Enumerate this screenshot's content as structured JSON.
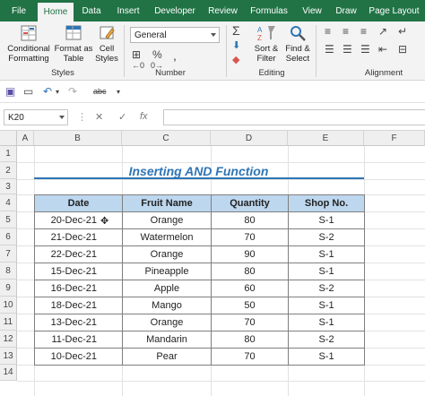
{
  "tabs": [
    {
      "label": "File",
      "active": false
    },
    {
      "label": "Home",
      "active": true
    },
    {
      "label": "Data",
      "active": false
    },
    {
      "label": "Insert",
      "active": false
    },
    {
      "label": "Developer",
      "active": false
    },
    {
      "label": "Review",
      "active": false
    },
    {
      "label": "Formulas",
      "active": false
    },
    {
      "label": "View",
      "active": false
    },
    {
      "label": "Draw",
      "active": false
    },
    {
      "label": "Page Layout",
      "active": false
    }
  ],
  "ribbon": {
    "styles": {
      "conditional_formatting": [
        "Conditional",
        "Formatting"
      ],
      "format_as_table": [
        "Format as",
        "Table"
      ],
      "cell_styles": [
        "Cell",
        "Styles"
      ],
      "group_label": "Styles"
    },
    "number": {
      "format_value": "General",
      "group_label": "Number"
    },
    "editing": {
      "sort_filter": [
        "Sort &",
        "Filter"
      ],
      "find_select": [
        "Find &",
        "Select"
      ],
      "group_label": "Editing"
    },
    "alignment": {
      "group_label": "Alignment"
    }
  },
  "formula_bar": {
    "name_box": "K20",
    "formula": ""
  },
  "columns": [
    "A",
    "B",
    "C",
    "D",
    "E",
    "F"
  ],
  "rows": [
    "1",
    "2",
    "3",
    "4",
    "5",
    "6",
    "7",
    "8",
    "9",
    "10",
    "11",
    "12",
    "13",
    "14"
  ],
  "sheet": {
    "title": "Inserting AND Function",
    "headers": [
      "Date",
      "Fruit Name",
      "Quantity",
      "Shop No."
    ],
    "records": [
      [
        "20-Dec-21",
        "Orange",
        "80",
        "S-1"
      ],
      [
        "21-Dec-21",
        "Watermelon",
        "70",
        "S-2"
      ],
      [
        "22-Dec-21",
        "Orange",
        "90",
        "S-1"
      ],
      [
        "15-Dec-21",
        "Pineapple",
        "80",
        "S-1"
      ],
      [
        "16-Dec-21",
        "Apple",
        "60",
        "S-2"
      ],
      [
        "18-Dec-21",
        "Mango",
        "50",
        "S-1"
      ],
      [
        "13-Dec-21",
        "Orange",
        "70",
        "S-1"
      ],
      [
        "11-Dec-21",
        "Mandarin",
        "80",
        "S-2"
      ],
      [
        "10-Dec-21",
        "Pear",
        "70",
        "S-1"
      ]
    ]
  },
  "colors": {
    "ribbon_green": "#217346",
    "title_blue": "#2e75b6",
    "header_fill": "#bdd7ee"
  }
}
